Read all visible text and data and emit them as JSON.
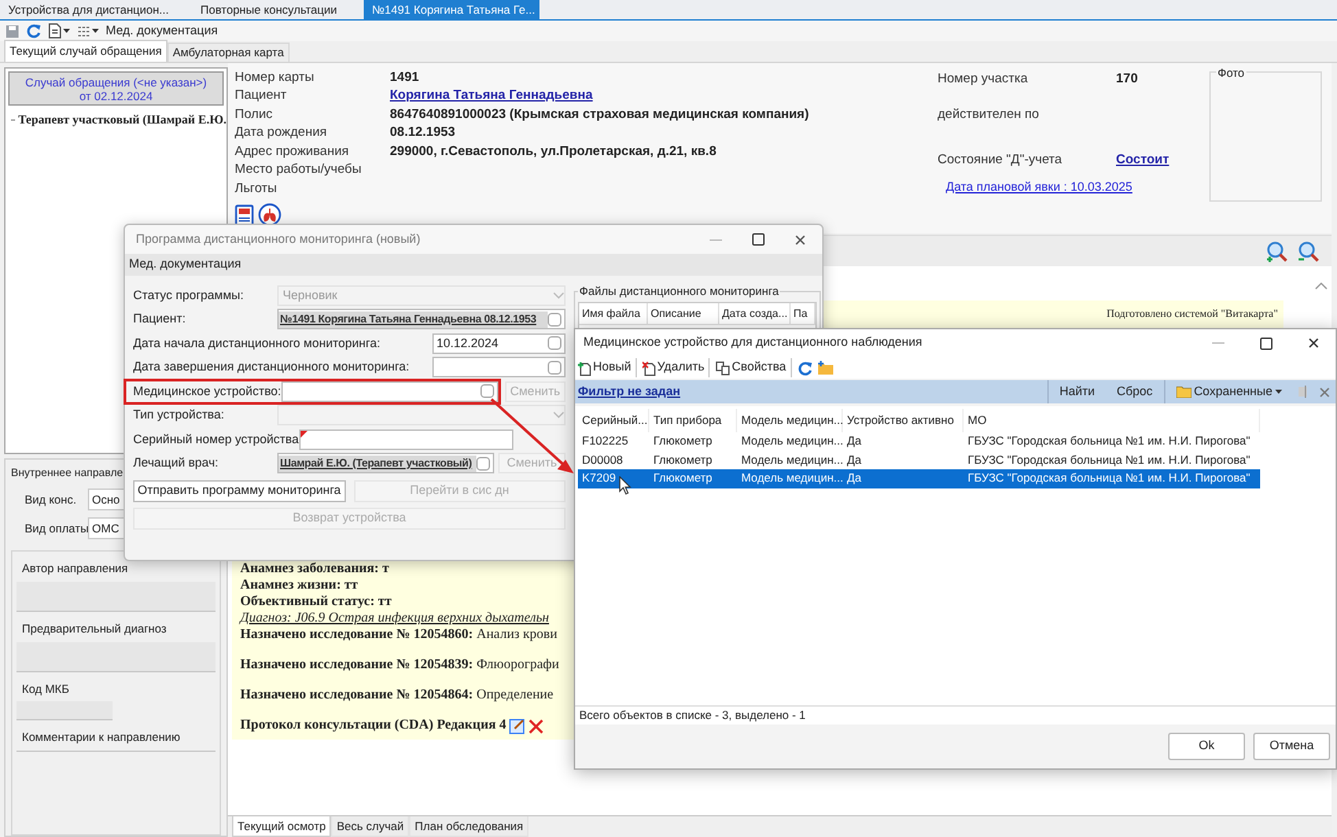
{
  "main_tabs": [
    {
      "label": "Устройства для дистанцион...",
      "selected": false
    },
    {
      "label": "Повторные консультации",
      "selected": false
    },
    {
      "label": "№1491 Корягина Татьяна Ге...",
      "selected": true
    }
  ],
  "toolbar": {
    "menu": "Мед. документация"
  },
  "case_tabs": [
    {
      "label": "Текущий случай обращения",
      "selected": true
    },
    {
      "label": "Амбулаторная карта",
      "selected": false
    }
  ],
  "case_panel": {
    "title": "Случай обращения (<не указан>)",
    "date": "от 02.12.2024",
    "tree": [
      {
        "label": "Терапевт участковый (Шамрай Е.Ю."
      }
    ]
  },
  "patient": [
    {
      "label": "Номер карты",
      "value": "1491",
      "kind": "text"
    },
    {
      "label": "Пациент",
      "value": "Корягина Татьяна Геннадьевна",
      "kind": "link"
    },
    {
      "label": "Полис",
      "value": "8647640891000023 (Крымская страховая медицинская компания)",
      "kind": "text"
    },
    {
      "label": "Дата рождения",
      "value": "08.12.1953",
      "kind": "text"
    },
    {
      "label": "Адрес проживания",
      "value": "299000, г.Севастополь, ул.Пролетарская, д.21, кв.8",
      "kind": "text"
    },
    {
      "label": "Место работы/учебы"
    },
    {
      "label": "Льготы"
    }
  ],
  "registration": [
    {
      "label": "Номер участка",
      "value": "170",
      "kind": "text"
    },
    {
      "label": "действителен по"
    },
    {
      "label": "Состояние \"Д\"-учета",
      "value": "Состоит",
      "kind": "link"
    }
  ],
  "planned_visit": "Дата плановой явки : 10.03.2025",
  "photo": {
    "title": "Фото"
  },
  "referral": {
    "title": "Внутреннее направле",
    "fields": [
      {
        "label": "Вид конс.",
        "value": "Осно"
      },
      {
        "label": "Вид оплаты",
        "value": "ОМС"
      }
    ],
    "sections": [
      "Автор направления",
      "Предварительный диагноз",
      "Код МКБ",
      "Комментарии к направлению"
    ]
  },
  "document": {
    "credit": "Подготовлено системой \"Витакарта\"",
    "lines": [
      {
        "kind": "record",
        "text": "Анамнез заболевания: т"
      },
      {
        "kind": "record",
        "text": "Анамнез жизни: тт"
      },
      {
        "kind": "record",
        "text": "Объективный статус: тт"
      },
      {
        "kind": "diagnosis",
        "text": "Диагноз: J06.9 Острая инфекция верхних дыхательн"
      },
      {
        "kind": "order",
        "text": "**Назначено исследование № 12054860:** Анализ крови"
      },
      {
        "kind": "order",
        "text": "**Назначено исследование № 12054839:** Флюорографи"
      },
      {
        "kind": "order",
        "text": "**Назначено исследование № 12054864:** Определение"
      },
      {
        "kind": "protocol",
        "text": "Протокол консультации (CDA) Редакция 4"
      }
    ],
    "tabs": [
      {
        "label": "Текущий осмотр",
        "selected": true
      },
      {
        "label": "Весь случай",
        "selected": false
      },
      {
        "label": "План обследования",
        "selected": false
      }
    ]
  },
  "monitoring_dialog": {
    "title": "Программа дистанционного мониторинга (новый)",
    "menu": "Мед. документация",
    "rows": [
      {
        "label": "Статус программы:",
        "kind": "select",
        "value": "Черновик",
        "disabled": true
      },
      {
        "label": "Пациент:",
        "kind": "lookup",
        "value": "№1491 Корягина Татьяна Геннадьевна 08.12.1953"
      },
      {
        "label": "Дата начала дистанционного мониторинга:",
        "kind": "date",
        "value": "10.12.2024"
      },
      {
        "label": "Дата завершения дистанционного мониторинга:",
        "kind": "date"
      },
      {
        "label": "Медицинское устройство:",
        "kind": "lookup",
        "highlighted": true,
        "action": {
          "label": "Сменить",
          "disabled": true
        }
      },
      {
        "label": "Тип устройства:",
        "kind": "select",
        "disabled": true
      },
      {
        "label": "Серийный номер устройства",
        "kind": "text",
        "required": true
      },
      {
        "label": "Лечащий врач:",
        "kind": "lookup",
        "value": "Шамрай Е.Ю. (Терапевт участковый)",
        "action": {
          "label": "Сменить",
          "disabled": true
        }
      }
    ],
    "buttons": [
      {
        "label": "Отправить программу мониторинга",
        "disabled": false
      },
      {
        "label": "Перейти в сис дн",
        "disabled": true
      },
      {
        "label": "Возврат устройства",
        "disabled": true
      }
    ],
    "files": {
      "title": "Файлы дистанционного мониторинга",
      "columns": [
        "Имя файла",
        "Описание",
        "Дата созда...",
        "Па"
      ]
    }
  },
  "device_dialog": {
    "title": "Медицинское устройство для дистанционного наблюдения",
    "toolbar": [
      "Новый",
      "Удалить",
      "Свойства"
    ],
    "filter": "Фильтр не задан",
    "filter_actions": [
      "Найти",
      "Сброс",
      "Сохраненные"
    ],
    "columns": [
      "Серийный...",
      "Тип прибора",
      "Модель медицин...",
      "Устройство активно",
      "МО"
    ],
    "rows": [
      {
        "cells": [
          "F102225",
          "Глюкометр",
          "Модель медицин...",
          "Да",
          "ГБУЗС \"Городская больница №1 им. Н.И. Пирогова\""
        ],
        "selected": false
      },
      {
        "cells": [
          "D00008",
          "Глюкометр",
          "Модель медицин...",
          "Да",
          "ГБУЗС \"Городская больница №1 им. Н.И. Пирогова\""
        ],
        "selected": false
      },
      {
        "cells": [
          "K7209",
          "Глюкометр",
          "Модель медицин...",
          "Да",
          "ГБУЗС \"Городская больница №1 им. Н.И. Пирогова\""
        ],
        "selected": true
      }
    ],
    "status": "Всего объектов в списке - 3, выделено - 1",
    "buttons": [
      "Ok",
      "Отмена"
    ]
  }
}
